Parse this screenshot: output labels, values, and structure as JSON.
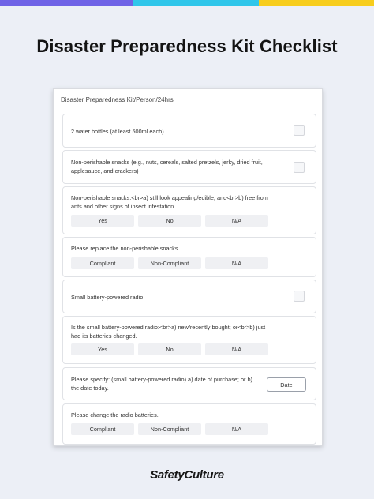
{
  "colors": {
    "bar_purple": "#6f63e6",
    "bar_cyan": "#30c6ea",
    "bar_yellow": "#f7cd1d",
    "background": "#eceff6"
  },
  "page_title": "Disaster Preparedness Kit Checklist",
  "card": {
    "header": "Disaster Preparedness Kit/Person/24hrs",
    "items": [
      {
        "text": "2 water bottles (at least 500ml each)",
        "type": "checkbox"
      },
      {
        "text": "Non-perishable snacks (e.g., nuts, cereals, salted pretzels, jerky, dried fruit, applesauce, and crackers)",
        "type": "checkbox"
      },
      {
        "text": "Non-perishable snacks:<br>a) still look appealing/edible; and<br>b) free from ants and other signs of insect infestation.",
        "type": "options",
        "options": [
          "Yes",
          "No",
          "N/A"
        ]
      },
      {
        "text": "Please replace the non-perishable snacks.",
        "type": "options",
        "options": [
          "Compliant",
          "Non-Compliant",
          "N/A"
        ]
      },
      {
        "text": "Small battery-powered radio",
        "type": "checkbox"
      },
      {
        "text": "Is the small battery-powered radio:<br>a) new/recently bought; or<br>b) just had its batteries changed.",
        "type": "options",
        "options": [
          "Yes",
          "No",
          "N/A"
        ]
      },
      {
        "text": "Please specify: (small battery-powered radio) a) date of purchase; or b) the date today.",
        "type": "date",
        "button": "Date"
      },
      {
        "text": "Please change the radio batteries.",
        "type": "options",
        "options": [
          "Compliant",
          "Non-Compliant",
          "N/A"
        ]
      }
    ]
  },
  "logo": "SafetyCulture"
}
